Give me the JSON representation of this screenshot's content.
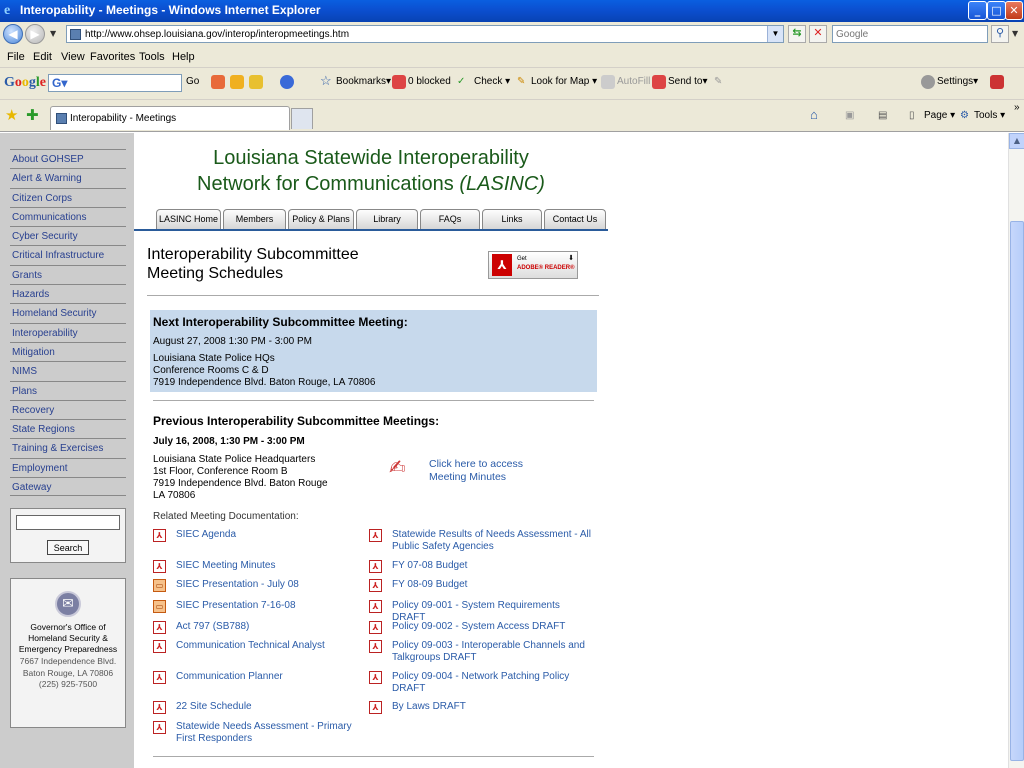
{
  "window": {
    "title": "Interopability - Meetings - Windows Internet Explorer",
    "controls": [
      "_",
      "□",
      "✕"
    ]
  },
  "address_bar": {
    "url": "http://www.ohsep.louisiana.gov/interop/interopmeetings.htm",
    "search_placeholder": "Google"
  },
  "menu": [
    "File",
    "Edit",
    "View",
    "Favorites",
    "Tools",
    "Help"
  ],
  "google_toolbar": {
    "logo": "Google",
    "search_value": "G▾",
    "go": "Go",
    "bookmarks": "Bookmarks▾",
    "blocked": "0 blocked",
    "check": "Check ▾",
    "look_for_map": "Look for Map ▾",
    "autofill": "AutoFill",
    "send_to": "Send to▾",
    "settings": "Settings▾"
  },
  "tabs": {
    "active_tab": "Interopability - Meetings",
    "page": "Page ▾",
    "tools": "Tools ▾"
  },
  "sidebar": {
    "items": [
      "About GOHSEP",
      "Alert & Warning",
      "Citizen Corps",
      "Communications",
      "Cyber Security",
      "Critical Infrastructure",
      "Grants",
      "Hazards",
      "Homeland Security",
      "Interoperability",
      "Mitigation",
      "NIMS",
      "Plans",
      "Recovery",
      "State Regions",
      "Training & Exercises",
      "Employment",
      "Gateway"
    ],
    "search_button": "Search",
    "org": [
      "Governor's Office of",
      "Homeland Security &",
      "Emergency Preparedness"
    ],
    "address": [
      "7667 Independence Blvd.",
      "Baton Rouge, LA 70806",
      "(225) 925-7500"
    ]
  },
  "site": {
    "title_line1": "Louisiana Statewide Interoperability",
    "title_line2": "Network for Communications ",
    "title_abbrev": "(LASINC)",
    "nav_tabs": [
      "LASINC Home",
      "Members",
      "Policy & Plans",
      "Library",
      "FAQs",
      "Links",
      "Contact Us"
    ]
  },
  "page": {
    "title_line1": "Interoperability Subcommittee",
    "title_line2": "Meeting Schedules",
    "adobe_get": "Get",
    "adobe_reader": "ADOBE® READER®",
    "next": {
      "heading": "Next Interoperability Subcommittee Meeting:",
      "date": "August 27, 2008  1:30 PM - 3:00 PM",
      "address": [
        "Louisiana State Police HQs",
        "Conference Rooms C & D",
        "7919 Independence Blvd. Baton Rouge, LA 70806"
      ]
    },
    "previous": {
      "heading": "Previous Interoperability Subcommittee Meetings:",
      "date": "July 16, 2008, 1:30 PM - 3:00 PM",
      "address": [
        "Louisiana State Police Headquarters",
        "1st Floor, Conference Room B",
        "7919 Independence Blvd.  Baton Rouge",
        "LA 70806"
      ],
      "minutes_link": [
        "Click here to access",
        "Meeting Minutes"
      ]
    },
    "related_heading": "Related Meeting Documentation:",
    "docs_left": [
      {
        "label": "SIEC Agenda",
        "type": "pdf"
      },
      {
        "label": "SIEC Meeting Minutes",
        "type": "pdf"
      },
      {
        "label": "SIEC Presentation - July 08",
        "type": "ppt"
      },
      {
        "label": "SIEC Presentation 7-16-08",
        "type": "ppt"
      },
      {
        "label": "Act 797 (SB788)",
        "type": "pdf"
      },
      {
        "label": "Communication Technical Analyst",
        "type": "pdf"
      },
      {
        "label": "Communication Planner",
        "type": "pdf"
      },
      {
        "label": "22 Site Schedule",
        "type": "pdf"
      },
      {
        "label": "Statewide Needs Assessment - Primary First Responders",
        "type": "pdf"
      }
    ],
    "docs_right": [
      {
        "label": "Statewide Results of Needs Assessment - All Public Safety Agencies",
        "type": "pdf"
      },
      {
        "label": "FY 07-08 Budget",
        "type": "pdf"
      },
      {
        "label": "FY 08-09 Budget",
        "type": "pdf"
      },
      {
        "label": "Policy 09-001 - System Requirements DRAFT",
        "type": "pdf"
      },
      {
        "label": "Policy 09-002 - System Access DRAFT",
        "type": "pdf"
      },
      {
        "label": "Policy 09-003 - Interoperable Channels and Talkgroups DRAFT",
        "type": "pdf"
      },
      {
        "label": "Policy 09-004 - Network Patching Policy DRAFT",
        "type": "pdf"
      },
      {
        "label": "By Laws DRAFT",
        "type": "pdf"
      }
    ]
  }
}
